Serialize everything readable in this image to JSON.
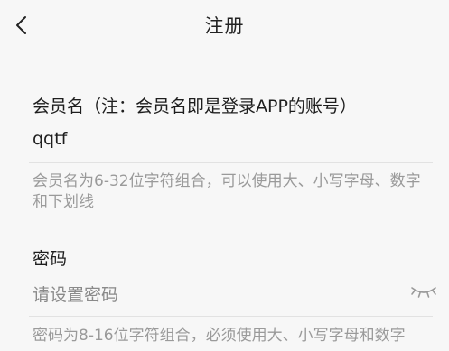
{
  "header": {
    "title": "注册"
  },
  "member": {
    "label": "会员名（注：会员名即是登录APP的账号）",
    "value": "qqtf",
    "hint": "会员名为6-32位字符组合，可以使用大、小写字母、数字和下划线"
  },
  "password": {
    "label": "密码",
    "placeholder": "请设置密码",
    "hint": "密码为8-16位字符组合，必须使用大、小写字母和数字"
  },
  "icons": {
    "back": "chevron-left-icon",
    "toggle_visibility": "eye-closed-icon"
  },
  "colors": {
    "background": "#f7f7f7",
    "text": "#1e1e1e",
    "hint": "#9a9a9a",
    "divider": "#e2e2e2"
  }
}
